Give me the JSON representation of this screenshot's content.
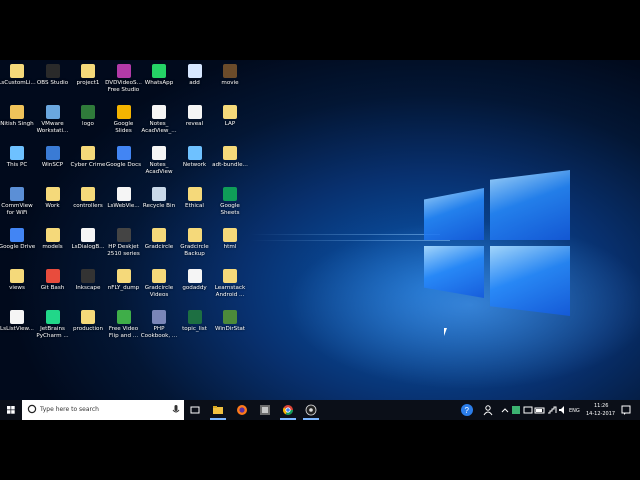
{
  "desktop_icons": [
    {
      "label": "LsCustomLi...",
      "color": "#f5d97a"
    },
    {
      "label": "OBS Studio",
      "color": "#2a2a2a"
    },
    {
      "label": "project1",
      "color": "#f5d97a"
    },
    {
      "label": "DVDVideoS...\nFree Studio",
      "color": "#b23aa8"
    },
    {
      "label": "WhatsApp",
      "color": "#25d366"
    },
    {
      "label": "add",
      "color": "#d7e7ff"
    },
    {
      "label": "movie",
      "color": "#6b4b2a"
    },
    {
      "label": "Nitish Singh",
      "color": "#f0c35a"
    },
    {
      "label": "VMware\nWorkstati...",
      "color": "#6aa7df"
    },
    {
      "label": "logo",
      "color": "#2f7b3a"
    },
    {
      "label": "Google Slides",
      "color": "#f4b400"
    },
    {
      "label": "Notes_\nAcadView_...",
      "color": "#f5f5f5"
    },
    {
      "label": "reveal",
      "color": "#f5f5f5"
    },
    {
      "label": "LAP",
      "color": "#f5d97a"
    },
    {
      "label": "This PC",
      "color": "#6ec1ff"
    },
    {
      "label": "WinSCP",
      "color": "#3a7bd5"
    },
    {
      "label": "Cyber Crime",
      "color": "#f5d97a"
    },
    {
      "label": "Google Docs",
      "color": "#4285f4"
    },
    {
      "label": "Notes_\nAcadView",
      "color": "#f5f5f5"
    },
    {
      "label": "Network",
      "color": "#6ec1ff"
    },
    {
      "label": "adt-bundle...",
      "color": "#f5d97a"
    },
    {
      "label": "CommView\nfor WiFi",
      "color": "#5b8fd6"
    },
    {
      "label": "Work",
      "color": "#f5d97a"
    },
    {
      "label": "controllers",
      "color": "#f5d97a"
    },
    {
      "label": "LsWebVie...",
      "color": "#f5f5f5"
    },
    {
      "label": "Recycle Bin",
      "color": "#c9d8e8"
    },
    {
      "label": "Ethical",
      "color": "#f5d97a"
    },
    {
      "label": "Google\nSheets",
      "color": "#0f9d58"
    },
    {
      "label": "Google Drive",
      "color": "#4285f4"
    },
    {
      "label": "models",
      "color": "#f5d97a"
    },
    {
      "label": "LsDialogB...",
      "color": "#f5f5f5"
    },
    {
      "label": "HP Deskjet\n2510 series",
      "color": "#444"
    },
    {
      "label": "Gradcircle",
      "color": "#f5d97a"
    },
    {
      "label": "Gradcircle\nBackup",
      "color": "#f5d97a"
    },
    {
      "label": "html",
      "color": "#f5d97a"
    },
    {
      "label": "views",
      "color": "#f5d97a"
    },
    {
      "label": "Git Bash",
      "color": "#e84c3d"
    },
    {
      "label": "Inkscape",
      "color": "#333"
    },
    {
      "label": "nFLY_dump",
      "color": "#f5d97a"
    },
    {
      "label": "Gradcircle\nVideos",
      "color": "#f5d97a"
    },
    {
      "label": "godaddy",
      "color": "#f5f5f5"
    },
    {
      "label": "Learnstack\nAndroid ...",
      "color": "#f5d97a"
    },
    {
      "label": "LsListView...",
      "color": "#f5f5f5"
    },
    {
      "label": "JetBrains\nPyCharm ...",
      "color": "#21d789"
    },
    {
      "label": "production",
      "color": "#f5d97a"
    },
    {
      "label": "Free Video\nFlip and ...",
      "color": "#3fae49"
    },
    {
      "label": "PHP\nCookbook, ...",
      "color": "#7a86b8"
    },
    {
      "label": "topic_list",
      "color": "#1d6f42"
    },
    {
      "label": "WinDirStat",
      "color": "#4c8a3a"
    }
  ],
  "taskbar": {
    "search_placeholder": "Type here to search",
    "language": "ENG",
    "time": "11:26",
    "date": "14-12-2017"
  },
  "colors": {
    "taskbar_bg": "#0b0f18",
    "accent": "#7cb6ff"
  }
}
